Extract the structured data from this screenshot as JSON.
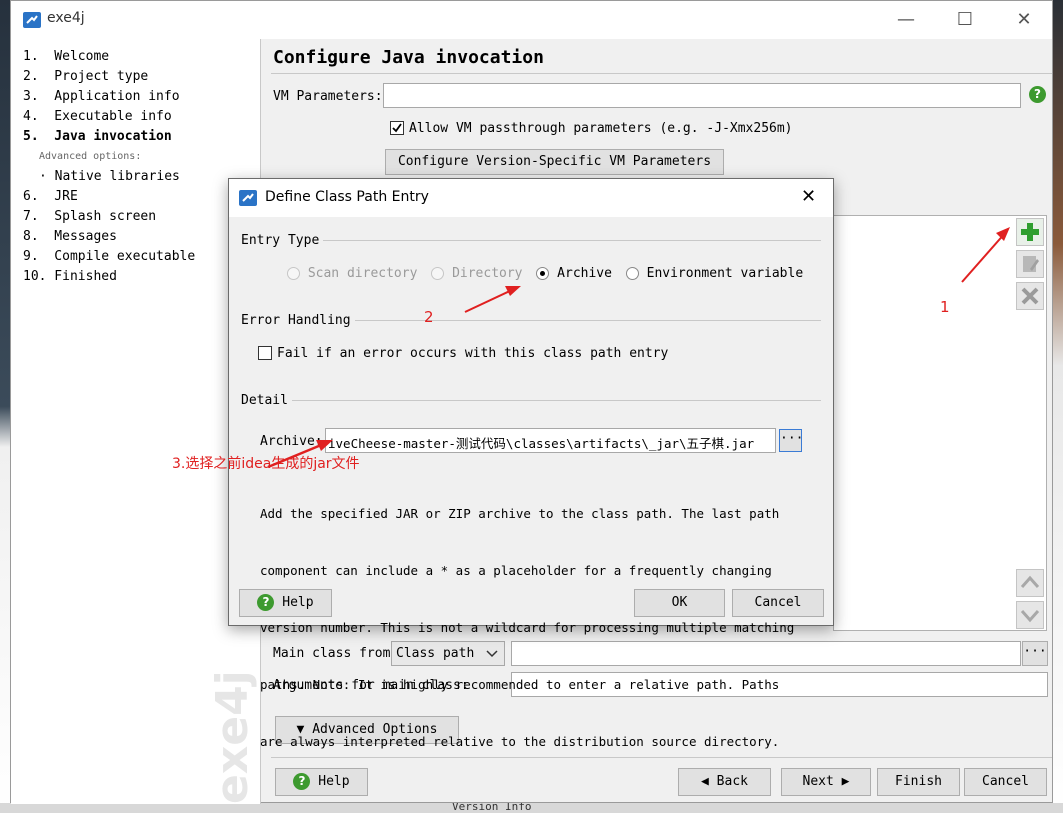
{
  "window": {
    "title": "exe4j",
    "minimize": "—",
    "maximize": "☐",
    "close": "✕"
  },
  "sidebar": {
    "steps": [
      {
        "label": "1.  Welcome"
      },
      {
        "label": "2.  Project type"
      },
      {
        "label": "3.  Application info"
      },
      {
        "label": "4.  Executable info"
      },
      {
        "label": "5.  Java invocation",
        "active": true
      },
      {
        "label": "6.  JRE"
      },
      {
        "label": "7.  Splash screen"
      },
      {
        "label": "8.  Messages"
      },
      {
        "label": "9.  Compile executable"
      },
      {
        "label": "10. Finished"
      }
    ],
    "advanced_label": "Advanced options:",
    "sub_item": "· Native libraries",
    "watermark": "exe4j"
  },
  "content": {
    "title": "Configure Java invocation",
    "vm_params_label": "VM Parameters:",
    "vm_params_value": "",
    "allow_passthrough_label": "Allow VM passthrough parameters (e.g. -J-Xmx256m)",
    "allow_passthrough_checked": true,
    "configure_version_btn": "Configure Version-Specific VM Parameters",
    "main_class_from_label": "Main class from",
    "main_class_from_value": "Class path",
    "main_class_value": "",
    "browse_btn": "···",
    "arguments_label": "Arguments for main class:",
    "arguments_value": "",
    "advanced_options_btn": "Advanced Options",
    "help_btn": "Help",
    "back_btn": "Back",
    "next_btn": "Next",
    "finish_btn": "Finish",
    "cancel_btn": "Cancel",
    "help_icon": "?"
  },
  "dialog": {
    "title": "Define Class Path Entry",
    "close": "✕",
    "entry_type_label": "Entry Type",
    "radio_options": [
      {
        "label": "Scan directory",
        "enabled": false,
        "checked": false
      },
      {
        "label": "Directory",
        "enabled": false,
        "checked": false
      },
      {
        "label": "Archive",
        "enabled": true,
        "checked": true
      },
      {
        "label": "Environment variable",
        "enabled": true,
        "checked": false
      }
    ],
    "error_handling_label": "Error Handling",
    "fail_checkbox_label": "Fail if an error occurs with this class path entry",
    "fail_checked": false,
    "detail_label": "Detail",
    "archive_label": "Archive:",
    "archive_value": "iveCheese-master-测试代码\\classes\\artifacts\\_jar\\五子棋.jar",
    "browse_btn": "···",
    "description": [
      "Add the specified JAR or ZIP archive to the class path. The last path",
      "component can include a * as a placeholder for a frequently changing",
      "version number. This is not a wildcard for processing multiple matching",
      "paths. Note: It is highly recommended to enter a relative path. Paths",
      "are always interpreted relative to the distribution source directory."
    ],
    "help_btn": "Help",
    "ok_btn": "OK",
    "cancel_btn": "Cancel"
  },
  "annotations": {
    "step1": "1",
    "step2": "2",
    "step3": "3.选择之前idea生成的jar文件",
    "color": "#e02020"
  },
  "background_fragments": {
    "bottom_text": "Version Info"
  }
}
